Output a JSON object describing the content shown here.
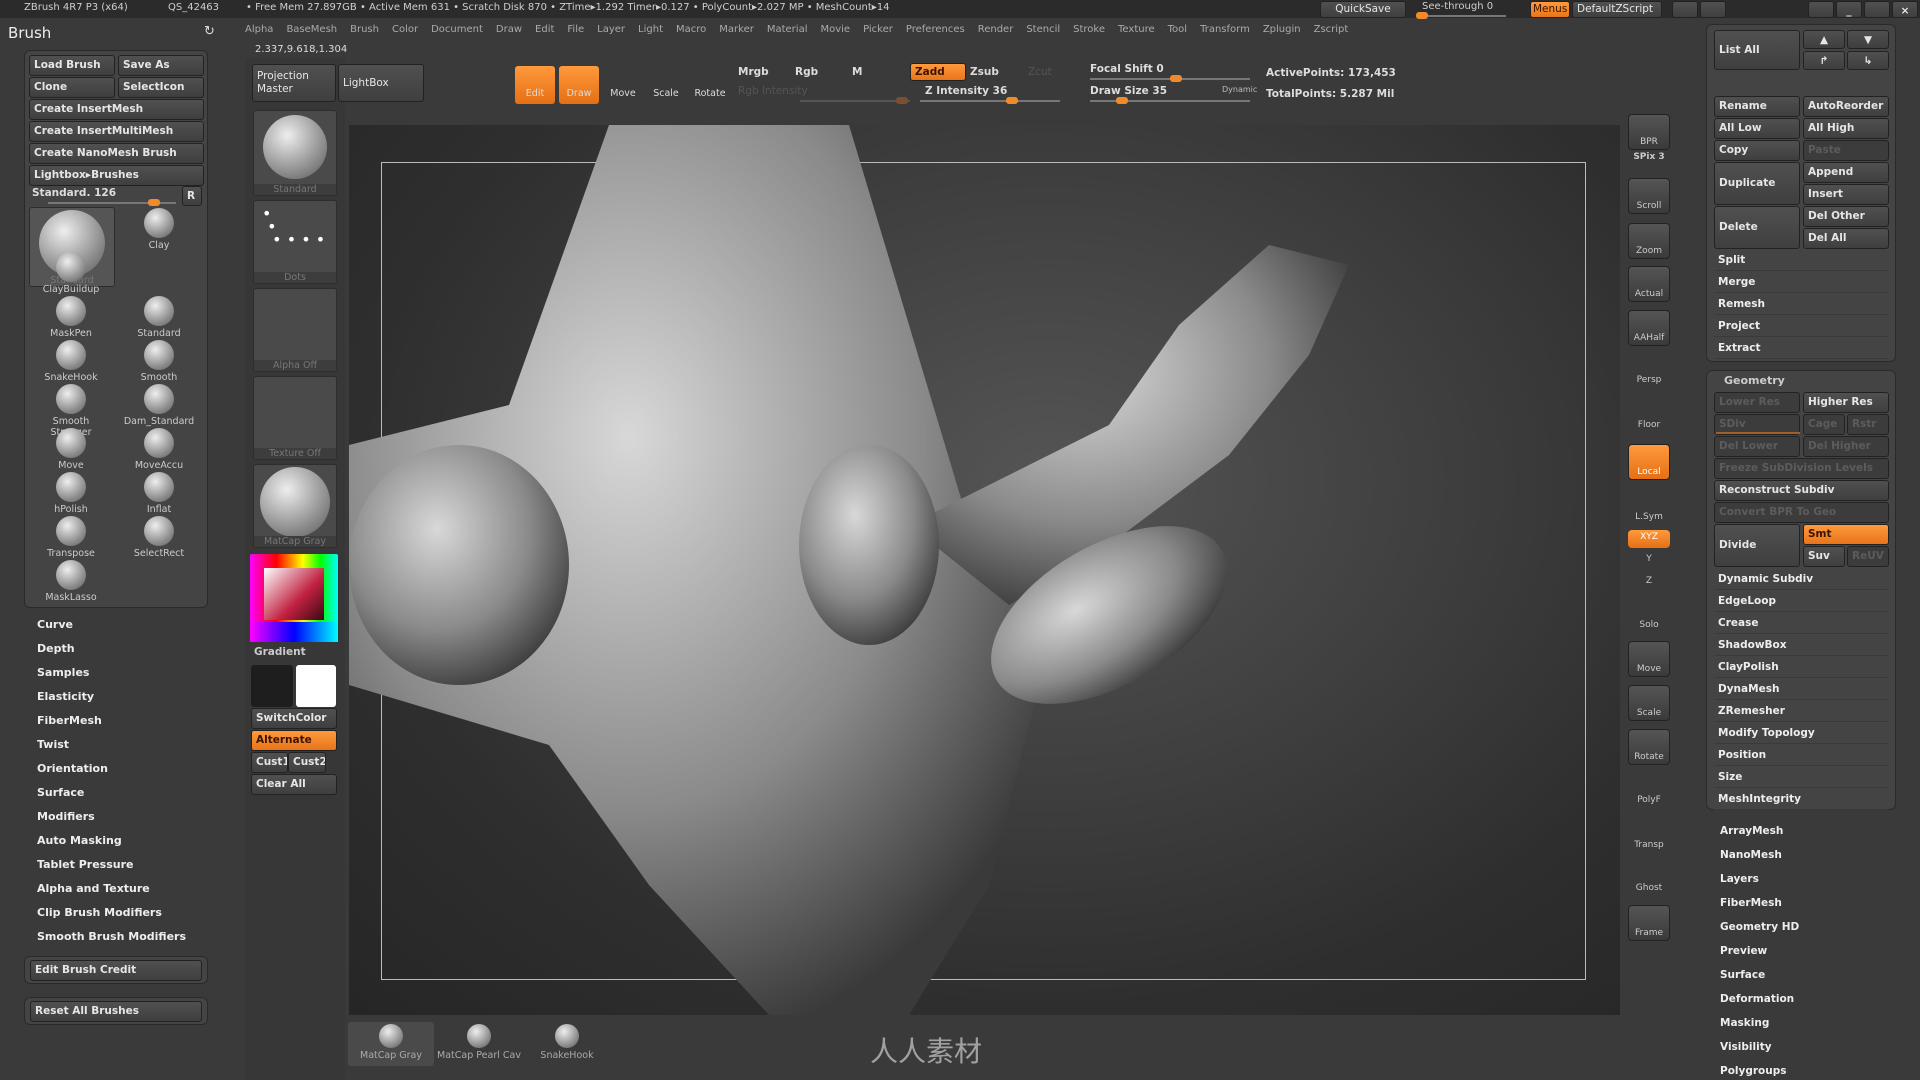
{
  "top_bar": {
    "title": "ZBrush 4R7 P3 (x64)",
    "build": "QS_42463",
    "stats": "• Free Mem 27.897GB • Active Mem 631 • Scratch Disk 870 • ZTime▸1.292 Timer▸0.127 • PolyCount▸2.027 MP • MeshCount▸14",
    "quicksave": "QuickSave",
    "see_through": "See-through 0",
    "see_through_value": 0,
    "menus": "Menus",
    "script": "DefaultZScript"
  },
  "menu": [
    "Alpha",
    "BaseMesh",
    "Brush",
    "Color",
    "Document",
    "Draw",
    "Edit",
    "File",
    "Layer",
    "Light",
    "Macro",
    "Marker",
    "Material",
    "Movie",
    "Picker",
    "Preferences",
    "Render",
    "Stencil",
    "Stroke",
    "Texture",
    "Tool",
    "Transform",
    "Zplugin",
    "Zscript"
  ],
  "coords": "2.337,9.618,1.304",
  "brush_panel": {
    "title": "Brush",
    "buttons": [
      "Load Brush",
      "Save As",
      "Clone",
      "SelectIcon"
    ],
    "wide": [
      "Create InsertMesh",
      "Create InsertMultiMesh",
      "Create NanoMesh Brush",
      "Lightbox▸Brushes"
    ],
    "current": "Standard. 126",
    "r": "R",
    "big": "Standard",
    "brushes": [
      "Clay",
      "ClayBuildup",
      "MaskPen",
      "Standard",
      "SnakeHook",
      "Smooth",
      "Smooth Stronger",
      "Dam_Standard",
      "Move",
      "MoveAccu",
      "hPolish",
      "Inflat",
      "Transpose",
      "SelectRect",
      "MaskLasso"
    ],
    "sections": [
      "Curve",
      "Depth",
      "Samples",
      "Elasticity",
      "FiberMesh",
      "Twist",
      "Orientation",
      "Surface",
      "Modifiers",
      "Auto Masking",
      "Tablet Pressure",
      "Alpha and Texture",
      "Clip Brush Modifiers",
      "Smooth Brush Modifiers"
    ],
    "edit_credit": "Edit Brush Credit",
    "reset": "Reset All Brushes"
  },
  "column2": {
    "projection": "Projection Master",
    "lightbox": "LightBox",
    "brush": "Standard",
    "stroke": "Dots",
    "alpha": "Alpha Off",
    "texture": "Texture Off",
    "material": "MatCap Gray",
    "gradient": "Gradient",
    "switch": "SwitchColor",
    "alternate": "Alternate",
    "cust1": "Cust1",
    "cust2": "Cust2",
    "clear": "Clear All",
    "colors": {
      "main": "#1e1e1e",
      "secondary": "#ffffff"
    }
  },
  "toolbar": {
    "edit": "Edit",
    "draw": "Draw",
    "move": "Move",
    "scale": "Scale",
    "rotate": "Rotate",
    "mrgb": "Mrgb",
    "rgb": "Rgb",
    "m": "M",
    "rgb_intensity": "Rgb Intensity",
    "zadd": "Zadd",
    "zsub": "Zsub",
    "zcut": "Zcut",
    "z_intensity": "Z Intensity 36",
    "focal": "Focal Shift 0",
    "draw_size": "Draw Size 35",
    "dynamic": "Dynamic",
    "active_points": "ActivePoints: 173,453",
    "total_points": "TotalPoints: 5.287 Mil"
  },
  "right_toolbar": [
    "BPR",
    "SPix 3",
    "Scroll",
    "Zoom",
    "Actual",
    "AAHalf",
    "Persp",
    "Floor",
    "Local",
    "L.Sym",
    "XYZ",
    "Y",
    "Z",
    "Solo",
    "Move",
    "Scale",
    "Rotate",
    "PolyF",
    "Transp",
    "Ghost",
    "Frame"
  ],
  "subtool": {
    "list_all": "List All",
    "rename": "Rename",
    "autoreorder": "AutoReorder",
    "all_low": "All Low",
    "all_high": "All High",
    "copy": "Copy",
    "paste": "Paste",
    "duplicate": "Duplicate",
    "append": "Append",
    "insert": "Insert",
    "delete": "Delete",
    "del_other": "Del Other",
    "del_all": "Del All",
    "items": [
      "Split",
      "Merge",
      "Remesh",
      "Project",
      "Extract"
    ]
  },
  "geometry": {
    "title": "Geometry",
    "lower_res": "Lower Res",
    "higher_res": "Higher Res",
    "sdiv": "SDiv",
    "cage": "Cage",
    "rstr": "Rstr",
    "del_lower": "Del Lower",
    "del_higher": "Del Higher",
    "freeze": "Freeze SubDivision Levels",
    "reconstruct": "Reconstruct Subdiv",
    "convert": "Convert BPR To Geo",
    "divide": "Divide",
    "smt": "Smt",
    "suv": "Suv",
    "reuv": "ReUV",
    "items": [
      "Dynamic Subdiv",
      "EdgeLoop",
      "Crease",
      "ShadowBox",
      "ClayPolish",
      "DynaMesh",
      "ZRemesher",
      "Modify Topology",
      "Position",
      "Size",
      "MeshIntegrity"
    ]
  },
  "tool_sections": [
    "ArrayMesh",
    "NanoMesh",
    "Layers",
    "FiberMesh",
    "Geometry HD",
    "Preview",
    "Surface",
    "Deformation",
    "Masking",
    "Visibility",
    "Polygroups"
  ],
  "shelf": [
    "MatCap Gray",
    "MatCap Pearl Cav",
    "SnakeHook"
  ],
  "watermark": "人人素材",
  "accent": "#f08a2a"
}
